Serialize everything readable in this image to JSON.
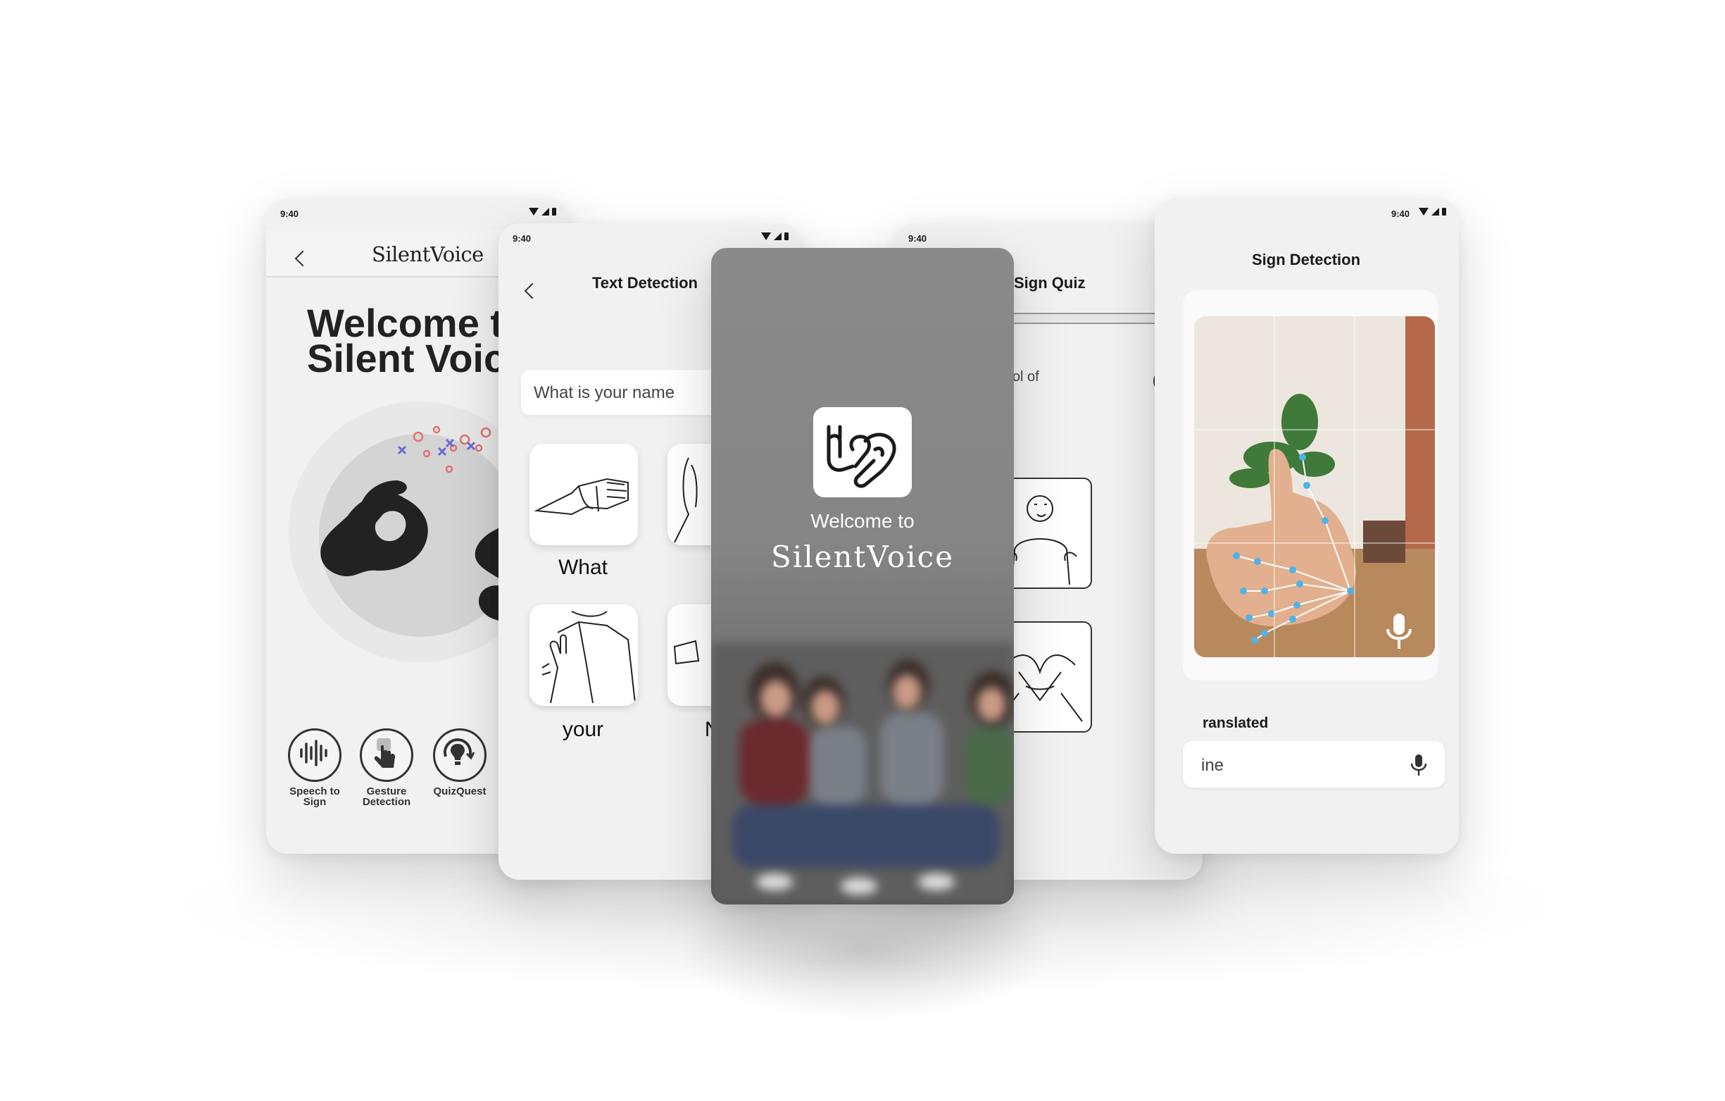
{
  "screens": {
    "home": {
      "time": "9:40",
      "brand": "SilentVoice",
      "welcome_line1": "Welcome t",
      "welcome_line2": "Silent Voic",
      "features": [
        {
          "label_line1": "Speech to",
          "label_line2": "Sign",
          "icon": "soundwave-icon"
        },
        {
          "label_line1": "Gesture",
          "label_line2": "Detection",
          "icon": "hand-tap-icon"
        },
        {
          "label_line1": "QuizQuest",
          "label_line2": "",
          "icon": "lightbulb-refresh-icon"
        }
      ]
    },
    "text_detection": {
      "time": "9:40",
      "title": "Text Detection",
      "input_value": "What is your name",
      "words": [
        "What",
        "your",
        "Na"
      ]
    },
    "splash": {
      "welcome": "Welcome to",
      "brand": "SilentVoice"
    },
    "sign_quiz": {
      "time": "9:40",
      "title": "Sign Quiz",
      "progress": 0.09,
      "question": "se is the symbol of"
    },
    "sign_detection": {
      "time": "9:40",
      "title": "Sign Detection",
      "translated_label": "ranslated",
      "translated_value": "ine"
    }
  },
  "colors": {
    "accent": "#3d7fb8",
    "landmark": "#4fb3e8",
    "screen_bg": "#f1f1f1",
    "text_dark": "#1a1a1a"
  }
}
